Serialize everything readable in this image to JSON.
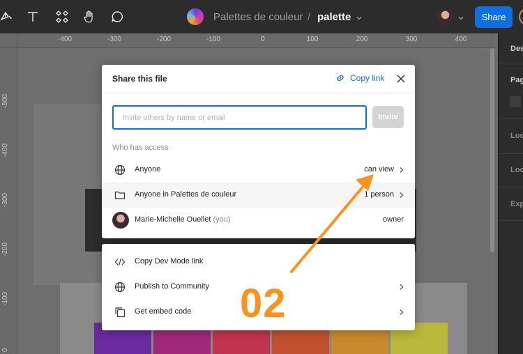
{
  "toolbar": {
    "project_name": "Palettes de couleur",
    "separator": "/",
    "page_name": "palette",
    "share_label": "Share"
  },
  "ruler": {
    "x_ticks": [
      "-400",
      "-300",
      "-200",
      "-100",
      "0",
      "100",
      "200",
      "300",
      "400"
    ],
    "y_ticks": [
      "-500",
      "-400",
      "-300",
      "-200",
      "-100",
      "0"
    ]
  },
  "right_panel": {
    "labels": [
      "Des",
      "Pag",
      "Loc",
      "Loc",
      "Exp"
    ]
  },
  "share_modal": {
    "title": "Share this file",
    "copy_link_label": "Copy link",
    "invite_placeholder": "Invite others by name or email",
    "invite_button_label": "Invite",
    "who_has_access_label": "Who has access",
    "access_rows": [
      {
        "label": "Anyone",
        "value": "can view",
        "icon": "globe-icon"
      },
      {
        "label": "Anyone in Palettes de couleur",
        "value": "1 person",
        "icon": "folder-icon"
      },
      {
        "label": "Marie-Michelle Ouellet",
        "you_suffix": "(you)",
        "value": "owner",
        "icon": "avatar"
      }
    ]
  },
  "more_menu": {
    "items": [
      {
        "label": "Copy Dev Mode link",
        "icon": "code-icon"
      },
      {
        "label": "Publish to Community",
        "icon": "globe-icon"
      },
      {
        "label": "Get embed code",
        "icon": "copy-icon"
      }
    ]
  },
  "canvas": {
    "swatch_colors": [
      "#6a2aa0",
      "#a0287a",
      "#c23350",
      "#c0502e",
      "#c88a2a",
      "#b9b83a"
    ]
  },
  "annotation": {
    "label": "02",
    "color": "#f7931e"
  }
}
